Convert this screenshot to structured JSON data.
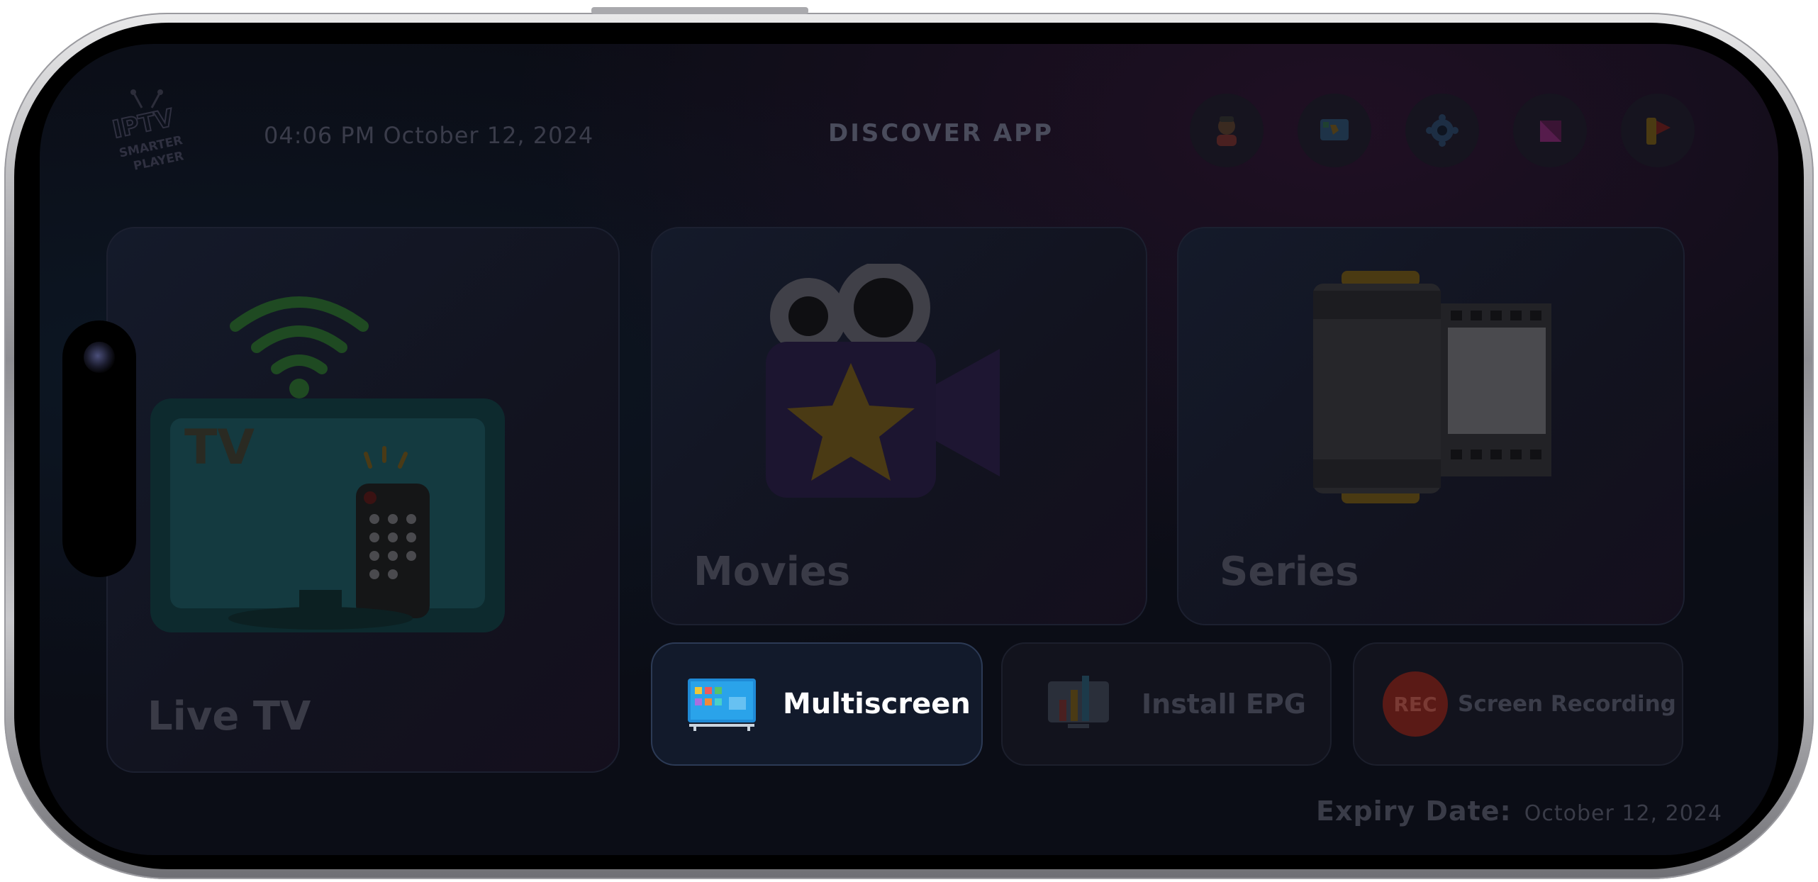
{
  "header": {
    "logo_text": [
      "IPTV",
      "SMARTER",
      "PLAYER"
    ],
    "datetime": "04:06 PM October 12, 2024",
    "discover": "DISCOVER APP",
    "app_icons": [
      "avatar-app-icon",
      "map-app-icon",
      "settings-app-icon",
      "pink-app-icon",
      "flag-app-icon"
    ]
  },
  "cards": {
    "live_tv": "Live TV",
    "live_tv_screen_text": "TV",
    "movies": "Movies",
    "series": "Series"
  },
  "actions": {
    "multiscreen": "Multiscreen",
    "install_epg": "Install EPG",
    "rec_badge": "REC",
    "screen_recording": "Screen Recording"
  },
  "footer": {
    "expiry_label": "Expiry Date:",
    "expiry_value": "October 12, 2024"
  },
  "colors": {
    "background": "#0b0d16",
    "active_border": "#2c3a55",
    "rec_red": "#5a1a16"
  }
}
